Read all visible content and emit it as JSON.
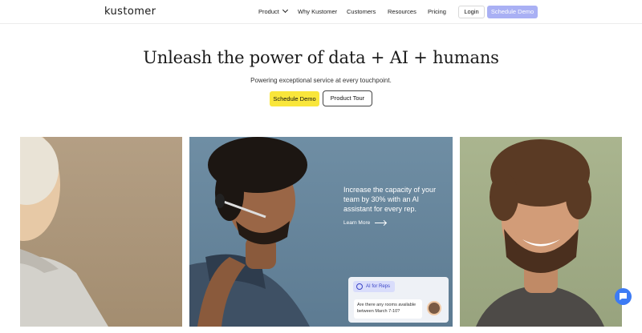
{
  "nav": {
    "logo": "kustomer",
    "links": [
      {
        "label": "Product"
      },
      {
        "label": "Why Kustomer"
      },
      {
        "label": "Customers"
      },
      {
        "label": "Resources"
      },
      {
        "label": "Pricing"
      }
    ],
    "login_label": "Login",
    "demo_label": "Schedule Demo"
  },
  "hero": {
    "title": "Unleash the power of data + AI + humans",
    "subtitle": "Powering exceptional service at every touchpoint.",
    "primary_cta": "Schedule Demo",
    "secondary_cta": "Product Tour"
  },
  "feature_card": {
    "copy": "Increase the capacity of your team by 30% with an AI assistant for every rep.",
    "link_label": "Learn More",
    "ai_chip_label": "AI for Reps",
    "chat_message": "Are there any rooms available between March 7-10?"
  },
  "colors": {
    "accent_yellow": "#f9e63b",
    "nav_demo_button": "#a9b0f4",
    "chat_widget": "#3d7bf4"
  },
  "icons": {
    "product_menu": "chevron-down-icon",
    "learn_more": "arrow-right-icon",
    "ai_chip": "sparkle-circle-icon",
    "chat_widget": "chat-bubble-icon"
  }
}
